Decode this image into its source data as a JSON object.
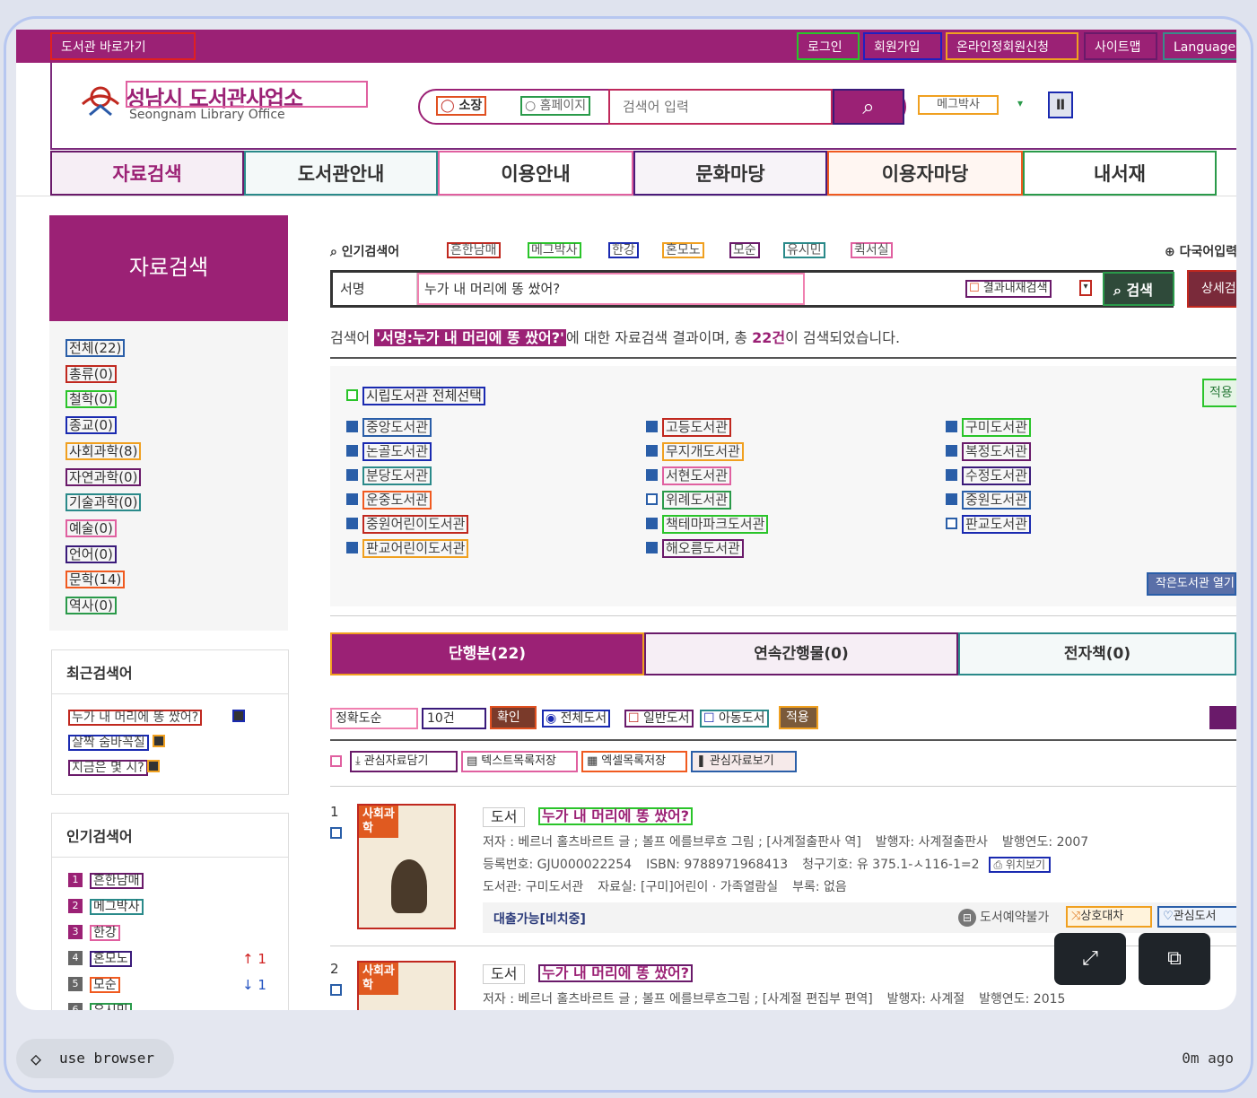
{
  "topbar": {
    "shortcut": "도서관 바로가기",
    "login": "로그인",
    "join": "회원가입",
    "online": "온라인정회원신청",
    "sitemap": "사이트맵",
    "language": "Language"
  },
  "header": {
    "logo_kr": "성남시 도서관사업소",
    "logo_en": "Seongnam Library Office",
    "radio1": "소장",
    "radio2": "홈페이지",
    "search_placeholder": "검색어 입력",
    "ticker": "메그박사"
  },
  "nav": [
    "자료검색",
    "도서관안내",
    "이용안내",
    "문화마당",
    "이용자마당",
    "내서재"
  ],
  "sidebar": {
    "title": "자료검색",
    "categories": [
      "전체(22)",
      "총류(0)",
      "철학(0)",
      "종교(0)",
      "사회과학(8)",
      "자연과학(0)",
      "기술과학(0)",
      "예술(0)",
      "언어(0)",
      "문학(14)",
      "역사(0)"
    ],
    "recent_title": "최근검색어",
    "recent": [
      "누가 내 머리에 똥 쌌어?",
      "살짝 숨바꼭질",
      "지금은 몇 시?"
    ],
    "popular_title": "인기검색어",
    "popular": [
      {
        "rank": "1",
        "term": "흔한남매"
      },
      {
        "rank": "2",
        "term": "메그박사"
      },
      {
        "rank": "3",
        "term": "한강"
      },
      {
        "rank": "4",
        "term": "혼모노",
        "delta": "↑ 1"
      },
      {
        "rank": "5",
        "term": "모순",
        "delta": "↓ 1"
      },
      {
        "rank": "6",
        "term": "유시민"
      }
    ]
  },
  "main": {
    "popular_label": "인기검색어",
    "popular_terms": [
      "흔한남매",
      "메그박사",
      "한강",
      "혼모노",
      "모순",
      "유시민",
      "퀵서실"
    ],
    "multilang": "다국어입력",
    "field": "서명",
    "query": "누가 내 머리에 똥 쌌어?",
    "rescan": "결과내재검색",
    "search_btn": "검색",
    "detail_btn": "상세검색",
    "summary_pre": "검색어 ",
    "summary_term": "'서명:누가 내 머리에 똥 쌌어?'",
    "summary_mid": "에 대한 자료검색 결과이며, 총 ",
    "summary_count": "22건",
    "summary_post": "이 검색되었습니다.",
    "all_libs": "시립도서관 전체선택",
    "apply": "적용",
    "small_libs": "작은도서관 열기",
    "libs": [
      [
        "중앙도서관",
        "고등도서관",
        "구미도서관"
      ],
      [
        "논골도서관",
        "무지개도서관",
        "복정도서관"
      ],
      [
        "분당도서관",
        "서현도서관",
        "수정도서관"
      ],
      [
        "운중도서관",
        "위례도서관",
        "중원도서관"
      ],
      [
        "중원어린이도서관",
        "책테마파크도서관",
        "판교도서관"
      ],
      [
        "판교어린이도서관",
        "해오름도서관",
        ""
      ]
    ],
    "tabs": [
      "단행본(22)",
      "연속간행물(0)",
      "전자책(0)"
    ],
    "sort": "정확도순",
    "count": "10건",
    "confirm": "확인",
    "filter_all": "전체도서",
    "filter_general": "일반도서",
    "filter_child": "아동도서",
    "apply2": "적용",
    "tools": [
      "관심자료담기",
      "텍스트목록저장",
      "엑셀목록저장",
      "관심자료보기"
    ],
    "results": [
      {
        "no": "1",
        "tag": "사회과학",
        "type": "도서",
        "title": "누가 내 머리에 똥 쌌어?",
        "author": "저자 : 베르너 홀츠바르트 글 ; 볼프 에를브루흐 그림 ; [사계절출판사 역]",
        "publisher": "발행자: 사계절출판사",
        "year": "발행연도: 2007",
        "reg": "등록번호: GJU000022254",
        "isbn": "ISBN: 9788971968413",
        "call": "청구기호: 유 375.1-ㅅ116-1=2",
        "loc": "위치보기",
        "lib": "도서관: 구미도서관",
        "room": "자료실: [구미]어린이 · 가족열람실",
        "extra": "부록: 없음",
        "status": "대출가능[비치중]",
        "reserve": "도서예약불가",
        "ill": "상호대차",
        "fav": "관심도서"
      },
      {
        "no": "2",
        "tag": "사회과학",
        "type": "도서",
        "title": "누가 내 머리에 똥 쌌어?",
        "author": "저자 : 베르너 홀츠바르트 글 ; 볼프 에를브루흐그림 ; [사계절 편집부 편역]",
        "publisher": "발행자: 사계절",
        "year": "발행연도: 2015"
      }
    ]
  },
  "agent": {
    "tool": "use browser",
    "time": "0m ago"
  }
}
